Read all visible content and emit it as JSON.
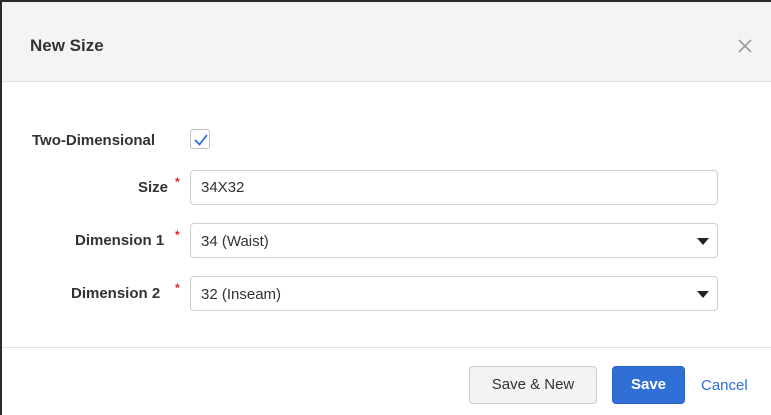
{
  "dialog": {
    "title": "New Size",
    "close_icon": "close-icon"
  },
  "form": {
    "two_dimensional": {
      "label": "Two-Dimensional",
      "checked": true
    },
    "size": {
      "label": "Size",
      "required_mark": "*",
      "value": "34X32"
    },
    "dimension1": {
      "label": "Dimension 1",
      "required_mark": "*",
      "value": "34 (Waist)"
    },
    "dimension2": {
      "label": "Dimension 2",
      "required_mark": "*",
      "value": "32 (Inseam)"
    }
  },
  "footer": {
    "save_new_label": "Save & New",
    "save_label": "Save",
    "cancel_label": "Cancel"
  },
  "colors": {
    "primary": "#2f6fd6",
    "required": "#e02424",
    "header_bg": "#f4f4f4"
  }
}
